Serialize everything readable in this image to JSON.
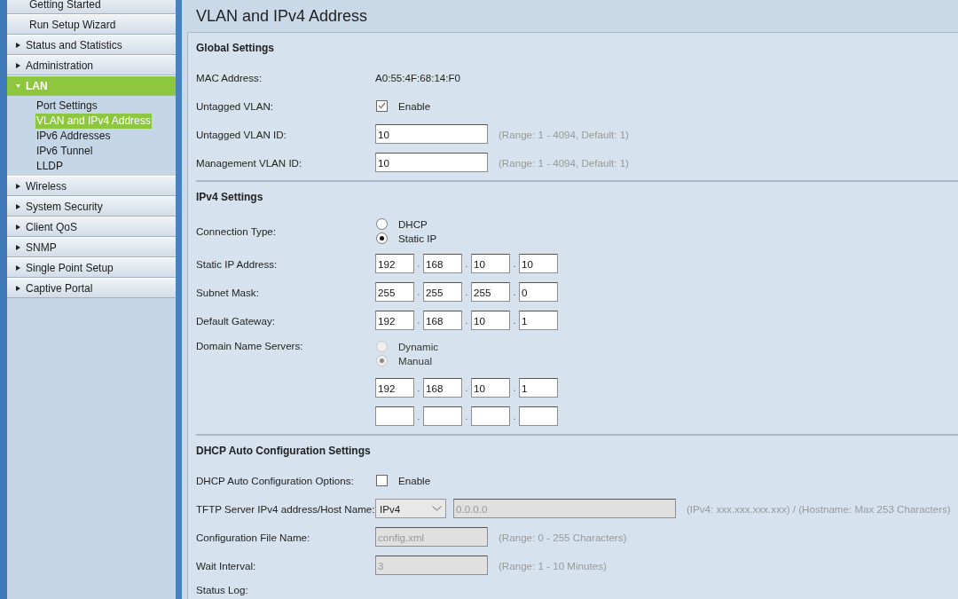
{
  "sidebar": {
    "items": [
      {
        "kind": "link",
        "label": "Getting Started"
      },
      {
        "kind": "link",
        "label": "Run Setup Wizard"
      },
      {
        "kind": "group",
        "label": "Status and Statistics",
        "expanded": false
      },
      {
        "kind": "group",
        "label": "Administration",
        "expanded": false
      },
      {
        "kind": "group",
        "label": "LAN",
        "expanded": true,
        "children": [
          {
            "label": "Port Settings",
            "selected": false
          },
          {
            "label": "VLAN and IPv4 Address",
            "selected": true
          },
          {
            "label": "IPv6 Addresses",
            "selected": false
          },
          {
            "label": "IPv6 Tunnel",
            "selected": false
          },
          {
            "label": "LLDP",
            "selected": false
          }
        ]
      },
      {
        "kind": "group",
        "label": "Wireless",
        "expanded": false
      },
      {
        "kind": "group",
        "label": "System Security",
        "expanded": false
      },
      {
        "kind": "group",
        "label": "Client QoS",
        "expanded": false
      },
      {
        "kind": "group",
        "label": "SNMP",
        "expanded": false
      },
      {
        "kind": "group",
        "label": "Single Point Setup",
        "expanded": false
      },
      {
        "kind": "group",
        "label": "Captive Portal",
        "expanded": false
      }
    ]
  },
  "page_title": "VLAN and IPv4 Address",
  "sections": [
    {
      "title": "Global Settings",
      "rows": [
        {
          "kind": "text",
          "label": "MAC Address:",
          "value": "A0:55:4F:68:14:F0"
        },
        {
          "kind": "checkbox",
          "label": "Untagged VLAN:",
          "option": "Enable",
          "checked": true
        },
        {
          "kind": "input",
          "label": "Untagged VLAN ID:",
          "value": "10",
          "hint": "(Range: 1 - 4094, Default: 1)",
          "disabled": false
        },
        {
          "kind": "input",
          "label": "Management VLAN ID:",
          "value": "10",
          "hint": "(Range: 1 - 4094, Default: 1)",
          "disabled": false
        }
      ]
    },
    {
      "title": "IPv4 Settings",
      "rows": [
        {
          "kind": "radio",
          "label": "Connection Type:",
          "options": [
            {
              "label": "DHCP",
              "selected": false,
              "disabled": false
            },
            {
              "label": "Static IP",
              "selected": true,
              "disabled": false
            }
          ]
        },
        {
          "kind": "ip",
          "label": "Static IP Address:",
          "octets": [
            "192",
            "168",
            "10",
            "10"
          ],
          "separators": [
            ".",
            ".",
            "."
          ]
        },
        {
          "kind": "ip",
          "label": "Subnet Mask:",
          "octets": [
            "255",
            "255",
            "255",
            "0"
          ],
          "separators": [
            ".",
            ".",
            "."
          ]
        },
        {
          "kind": "ip",
          "label": "Default Gateway:",
          "octets": [
            "192",
            "168",
            "10",
            "1"
          ],
          "separators": [
            ".",
            ".",
            "."
          ]
        },
        {
          "kind": "radio_top",
          "label": "Domain Name Servers:",
          "options": [
            {
              "label": "Dynamic",
              "selected": false,
              "disabled": true
            },
            {
              "label": "Manual",
              "selected": true,
              "disabled": true
            }
          ]
        },
        {
          "kind": "ip",
          "octets": [
            "192",
            "168",
            "10",
            "1"
          ],
          "separators": [
            ".",
            ".",
            "."
          ]
        },
        {
          "kind": "ip_blank",
          "separators": [
            ".",
            ".",
            "."
          ]
        }
      ]
    },
    {
      "title": "DHCP Auto Configuration Settings",
      "rows": [
        {
          "kind": "checkbox",
          "label": "DHCP Auto Configuration Options:",
          "option": "Enable",
          "checked": false
        },
        {
          "kind": "select",
          "label": "TFTP Server IPv4 address/Host Name:",
          "selected_option": "IPv4",
          "value": "0.0.0.0",
          "hint": "(IPv4: xxx.xxx.xxx.xxx) / (Hostname: Max 253 Characters)",
          "disabled": true
        },
        {
          "kind": "input",
          "label": "Configuration File Name:",
          "value": "config.xml",
          "hint": "(Range: 0 - 255 Characters)",
          "disabled": true
        },
        {
          "kind": "input",
          "label": "Wait Interval:",
          "value": "3",
          "hint": "(Range: 1 - 10 Minutes)",
          "disabled": true
        },
        {
          "kind": "label",
          "label": "Status Log:"
        }
      ]
    }
  ]
}
